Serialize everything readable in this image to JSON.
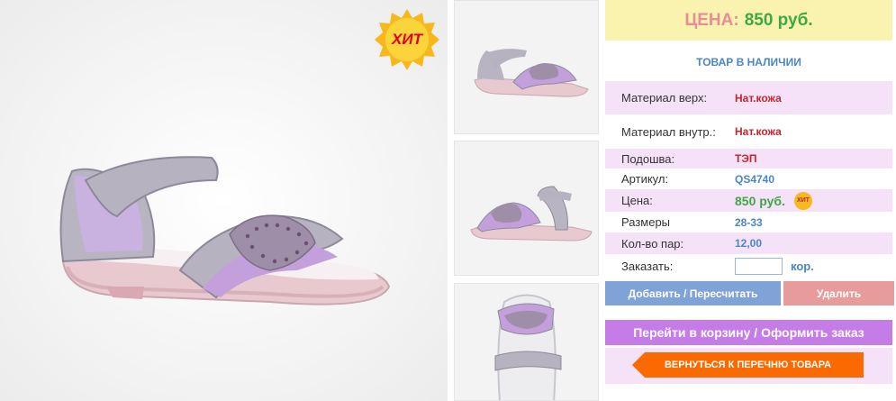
{
  "badge": {
    "hit": "ХИТ"
  },
  "price_header": {
    "label": "ЦЕНА:",
    "value": "850 руб."
  },
  "stock": "ТОВАР В НАЛИЧИИ",
  "specs": [
    {
      "label": "Материал верх:",
      "value": "Нат.кожа"
    },
    {
      "label": "Материал внутр.:",
      "value": "Нат.кожа"
    },
    {
      "label": "Подошва:",
      "value": "ТЭП"
    },
    {
      "label": "Артикул:",
      "value": "QS4740"
    },
    {
      "label": "Цена:",
      "value": "850 руб.",
      "badge": "ХИТ"
    },
    {
      "label": "Размеры",
      "value": "28-33"
    },
    {
      "label": "Кол-во пар:",
      "value": "12,00"
    }
  ],
  "order": {
    "label": "Заказать:",
    "value": "",
    "unit": "кор."
  },
  "buttons": {
    "add": "Добавить / Пересчитать",
    "delete": "Удалить",
    "cart": "Перейти в корзину / Оформить заказ",
    "back": "ВЕРНУТЬСЯ К ПЕРЕЧНЮ ТОВАРА"
  },
  "colors": {
    "price_bg": "#faf3b0",
    "accent_blue": "#4a86c8",
    "accent_red": "#c2272d",
    "accent_green": "#3ea845",
    "pink_row": "#f6e2f8",
    "cart_purple": "#c57ce6",
    "back_orange": "#fb6a00"
  }
}
